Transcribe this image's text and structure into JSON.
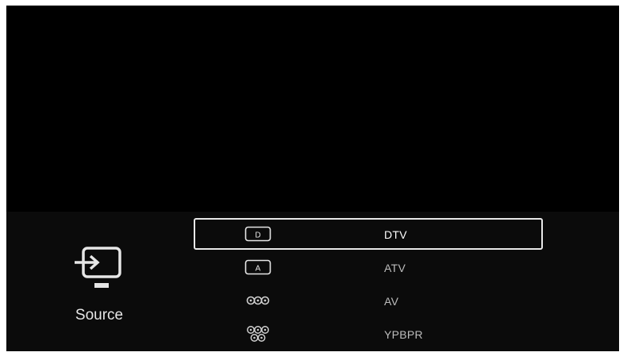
{
  "sidebar": {
    "icon": "input-source-icon",
    "label": "Source"
  },
  "sources": {
    "items": [
      {
        "label": "DTV",
        "icon": "dtv-icon",
        "icon_text": "D",
        "selected": true
      },
      {
        "label": "ATV",
        "icon": "atv-icon",
        "icon_text": "A",
        "selected": false
      },
      {
        "label": "AV",
        "icon": "av-connector-icon",
        "selected": false
      },
      {
        "label": "YPBPR",
        "icon": "ypbpr-connector-icon",
        "selected": false
      }
    ]
  },
  "colors": {
    "background": "#000000",
    "panel": "#0b0b0b",
    "text": "#e6e6e6",
    "selection_border": "#e9e9e9"
  }
}
